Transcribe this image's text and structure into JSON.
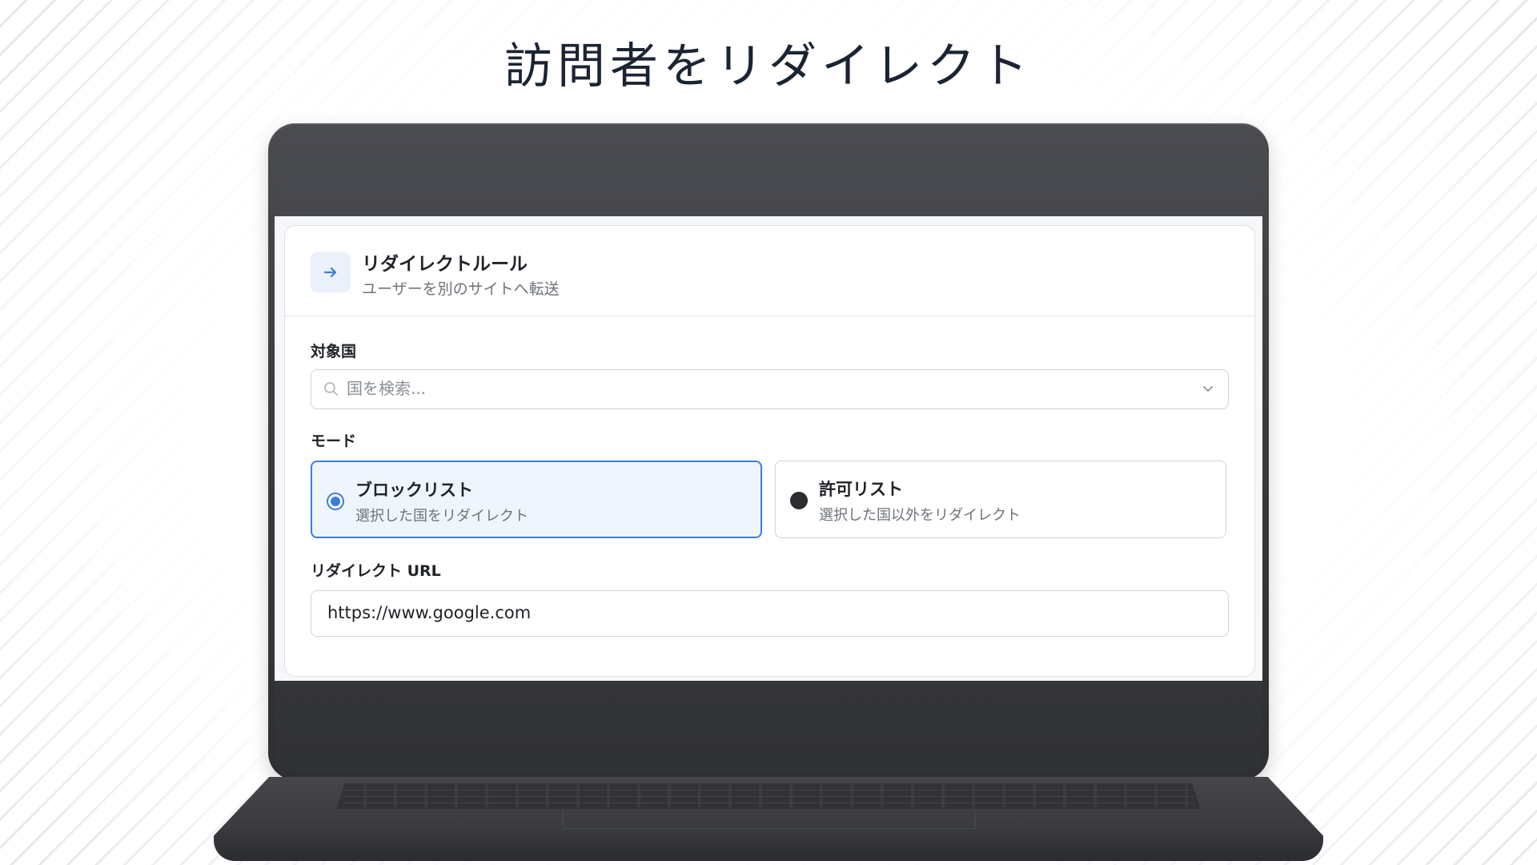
{
  "headline": "訪問者をリダイレクト",
  "card": {
    "icon": "arrow-right-icon",
    "title": "リダイレクトルール",
    "subtitle": "ユーザーを別のサイトへ転送"
  },
  "countries": {
    "label": "対象国",
    "placeholder": "国を検索...",
    "value": ""
  },
  "mode": {
    "label": "モード",
    "options": [
      {
        "title": "ブロックリスト",
        "description": "選択した国をリダイレクト",
        "selected": true
      },
      {
        "title": "許可リスト",
        "description": "選択した国以外をリダイレクト",
        "selected": false
      }
    ]
  },
  "redirect": {
    "label": "リダイレクト URL",
    "value": "https://www.google.com"
  },
  "colors": {
    "accent": "#3b7ddd",
    "laptop": "#3b3c40"
  }
}
